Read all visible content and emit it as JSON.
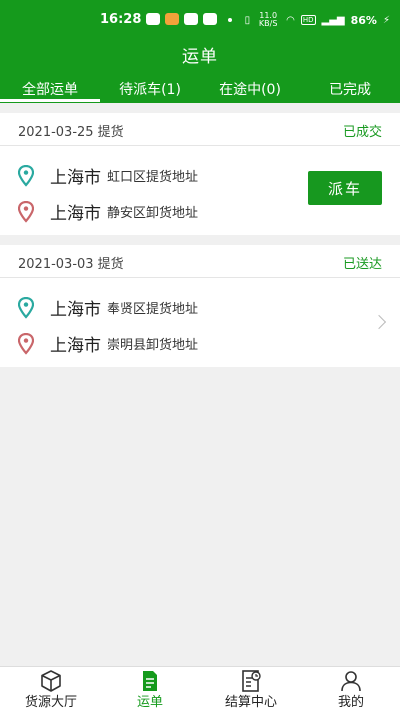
{
  "status_bar": {
    "time": "16:28",
    "net_speed": "11.0 KB/S",
    "battery": "86%"
  },
  "header": {
    "title": "运单"
  },
  "tabs": [
    {
      "label": "全部运单",
      "active": true
    },
    {
      "label": "待派车(1)",
      "active": false
    },
    {
      "label": "在途中(0)",
      "active": false
    },
    {
      "label": "已完成",
      "active": false
    }
  ],
  "orders": [
    {
      "date": "2021-03-25 提货",
      "status": "已成交",
      "pickup_city": "上海市",
      "pickup_address": "虹口区提货地址",
      "dropoff_city": "上海市",
      "dropoff_address": "静安区卸货地址",
      "action_label": "派车"
    },
    {
      "date": "2021-03-03 提货",
      "status": "已送达",
      "pickup_city": "上海市",
      "pickup_address": "奉贤区提货地址",
      "dropoff_city": "上海市",
      "dropoff_address": "崇明县卸货地址"
    }
  ],
  "bottom_nav": [
    {
      "label": "货源大厅",
      "icon": "box-icon",
      "active": false
    },
    {
      "label": "运单",
      "icon": "document-icon",
      "active": true
    },
    {
      "label": "结算中心",
      "icon": "settlement-icon",
      "active": false
    },
    {
      "label": "我的",
      "icon": "person-icon",
      "active": false
    }
  ],
  "colors": {
    "brand_green": "#159a1c",
    "pickup_pin": "#2aa9a0",
    "dropoff_pin": "#c9666a"
  }
}
